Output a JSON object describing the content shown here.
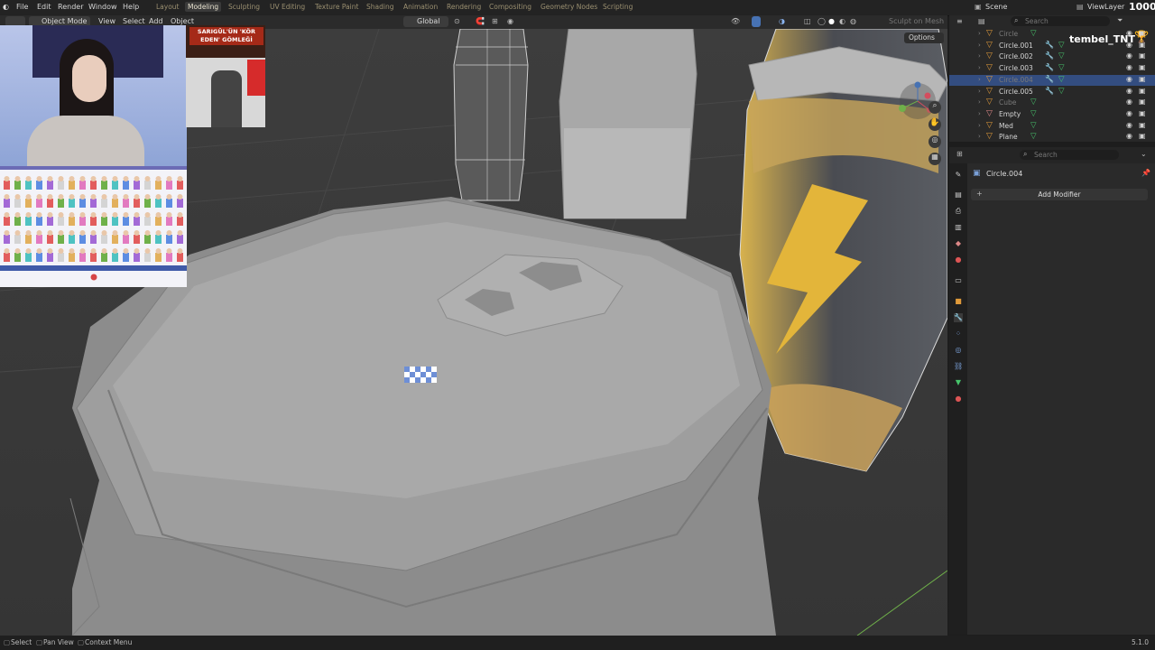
{
  "menu": {
    "items": [
      "File",
      "Edit",
      "Render",
      "Window",
      "Help"
    ],
    "workspaces": [
      "Layout",
      "Modeling",
      "Sculpting",
      "UV Editing",
      "Texture Paint",
      "Shading",
      "Animation",
      "Rendering",
      "Compositing",
      "Geometry Nodes",
      "Scripting"
    ],
    "active_workspace": "Modeling",
    "scene": "Scene",
    "view_layer": "ViewLayer"
  },
  "header": {
    "mode": "Object Mode",
    "view": "View",
    "select": "Select",
    "add": "Add",
    "object": "Object",
    "transform": "Global",
    "gizmo_hint": "Sculpt on Mesh",
    "options": "Options"
  },
  "outliner": {
    "search_placeholder": "Search",
    "items": [
      {
        "label": "Circle",
        "selected": false,
        "dim": true
      },
      {
        "label": "Circle.001",
        "selected": false,
        "dim": false
      },
      {
        "label": "Circle.002",
        "selected": false,
        "dim": false
      },
      {
        "label": "Circle.003",
        "selected": false,
        "dim": false
      },
      {
        "label": "Circle.004",
        "selected": true,
        "dim": true
      },
      {
        "label": "Circle.005",
        "selected": false,
        "dim": false
      },
      {
        "label": "Cube",
        "selected": false,
        "dim": true
      },
      {
        "label": "Empty",
        "selected": false,
        "dim": false
      },
      {
        "label": "Med",
        "selected": false,
        "dim": false
      },
      {
        "label": "Plane",
        "selected": false,
        "dim": false
      }
    ]
  },
  "properties": {
    "search_placeholder": "Search",
    "object_name": "Circle.004",
    "add_modifier": "Add Modifier"
  },
  "overlay": {
    "streamer_name": "tembel_TNT",
    "counter": "1000",
    "news_text": "SARIGÜL'ÜN 'KÖR EDEN' GÖMLEĞİ"
  },
  "status": {
    "select": "Select",
    "pan": "Pan View",
    "context": "Context Menu",
    "version": "5.1.0"
  },
  "colors": {
    "accent_blue": "#4772b3",
    "mesh_green": "#47c56b",
    "object_orange": "#e09a3a",
    "can_yellow": "#e3b53a"
  }
}
